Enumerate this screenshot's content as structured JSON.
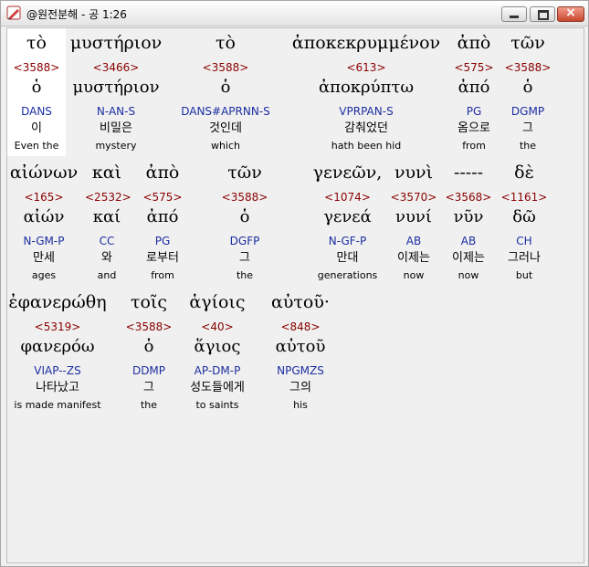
{
  "window": {
    "title": "@원전분해 - 공 1:26",
    "app_icon": "pencil-icon",
    "buttons": {
      "minimize": "minimize-icon",
      "maximize": "maximize-icon",
      "close_glyph": "×"
    }
  },
  "rows": [
    [
      {
        "greek": "τὸ",
        "strong": "<3588>",
        "lemma": "ὁ",
        "parse": "DANS",
        "korean": "이",
        "english": "Even the"
      },
      {
        "greek": "μυστήριον",
        "strong": "<3466>",
        "lemma": "μυστήριον",
        "parse": "N-AN-S",
        "korean": "비밀은",
        "english": "mystery"
      },
      {
        "greek": "τὸ",
        "strong": "<3588>",
        "lemma": "ὁ",
        "parse": "DANS#APRNN-S",
        "korean": "것인데",
        "english": "which"
      },
      {
        "greek": "ἀποκεκρυμμένον",
        "strong": "<613>",
        "lemma": "ἀποκρύπτω",
        "parse": "VPRPAN-S",
        "korean": "감춰었던",
        "english": "hath been hid"
      },
      {
        "greek": "ἀπὸ",
        "strong": "<575>",
        "lemma": "ἀπό",
        "parse": "PG",
        "korean": "옴으로",
        "english": "from"
      },
      {
        "greek": "τῶν",
        "strong": "<3588>",
        "lemma": "ὁ",
        "parse": "DGMP",
        "korean": "그",
        "english": "the"
      }
    ],
    [
      {
        "greek": "αἰώνων",
        "strong": "<165>",
        "lemma": "αἰών",
        "parse": "N-GM-P",
        "korean": "만세",
        "english": "ages"
      },
      {
        "greek": "καὶ",
        "strong": "<2532>",
        "lemma": "καί",
        "parse": "CC",
        "korean": "와",
        "english": "and"
      },
      {
        "greek": "ἀπὸ",
        "strong": "<575>",
        "lemma": "ἀπό",
        "parse": "PG",
        "korean": "로부터",
        "english": "from"
      },
      {
        "greek": "τῶν",
        "strong": "<3588>",
        "lemma": "ὁ",
        "parse": "DGFP",
        "korean": "그",
        "english": "the"
      },
      {
        "greek": "γενεῶν,",
        "strong": "<1074>",
        "lemma": "γενεά",
        "parse": "N-GF-P",
        "korean": "만대",
        "english": "generations"
      },
      {
        "greek": "νυνὶ",
        "strong": "<3570>",
        "lemma": "νυνί",
        "parse": "AB",
        "korean": "이제는",
        "english": "now"
      },
      {
        "greek": "-----",
        "strong": "<3568>",
        "lemma": "νῦν",
        "parse": "AB",
        "korean": "이제는",
        "english": "now"
      },
      {
        "greek": "δὲ",
        "strong": "<1161>",
        "lemma": "δῶ",
        "parse": "CH",
        "korean": "그러나",
        "english": "but"
      }
    ],
    [
      {
        "greek": "ἐφανερώθη",
        "strong": "<5319>",
        "lemma": "φανερόω",
        "parse": "VIAP--ZS",
        "korean": "나타났고",
        "english": "is made manifest"
      },
      {
        "greek": "τοῖς",
        "strong": "<3588>",
        "lemma": "ὁ",
        "parse": "DDMP",
        "korean": "그",
        "english": "the"
      },
      {
        "greek": "ἁγίοις",
        "strong": "<40>",
        "lemma": "ἅγιος",
        "parse": "AP-DM-P",
        "korean": "성도들에게",
        "english": "to saints"
      },
      {
        "greek": "αὐτοῦ·",
        "strong": "<848>",
        "lemma": "αὐτοῦ",
        "parse": "NPGMZS",
        "korean": "그의",
        "english": "his"
      }
    ]
  ]
}
